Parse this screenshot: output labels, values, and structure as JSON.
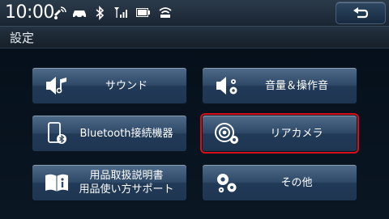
{
  "status_bar": {
    "time": "10:00",
    "icons": [
      "gps-signal-icon",
      "car-icon",
      "bluetooth-icon",
      "cell-signal-icon",
      "battery-icon",
      "wifi-icon"
    ]
  },
  "header": {
    "back_button_icon": "return-arrow-icon",
    "title": "設定"
  },
  "menu": {
    "items": [
      {
        "label": "サウンド",
        "icon": "speaker-music-icon"
      },
      {
        "label": "音量＆操作音",
        "icon": "speaker-gear-icon"
      },
      {
        "label": "Bluetooth接続機器",
        "icon": "phone-bluetooth-icon"
      },
      {
        "label": "リアカメラ",
        "icon": "camera-gear-icon",
        "selected": true
      },
      {
        "label_line1": "用品取扱説明書",
        "label_line2": "用品使い方サポート",
        "icon": "manual-book-icon"
      },
      {
        "label": "その他",
        "icon": "gears-icon"
      }
    ]
  },
  "colors": {
    "selection_border": "#d80f1a",
    "button_top": "#4f6b8a",
    "button_bottom": "#1f3652"
  }
}
